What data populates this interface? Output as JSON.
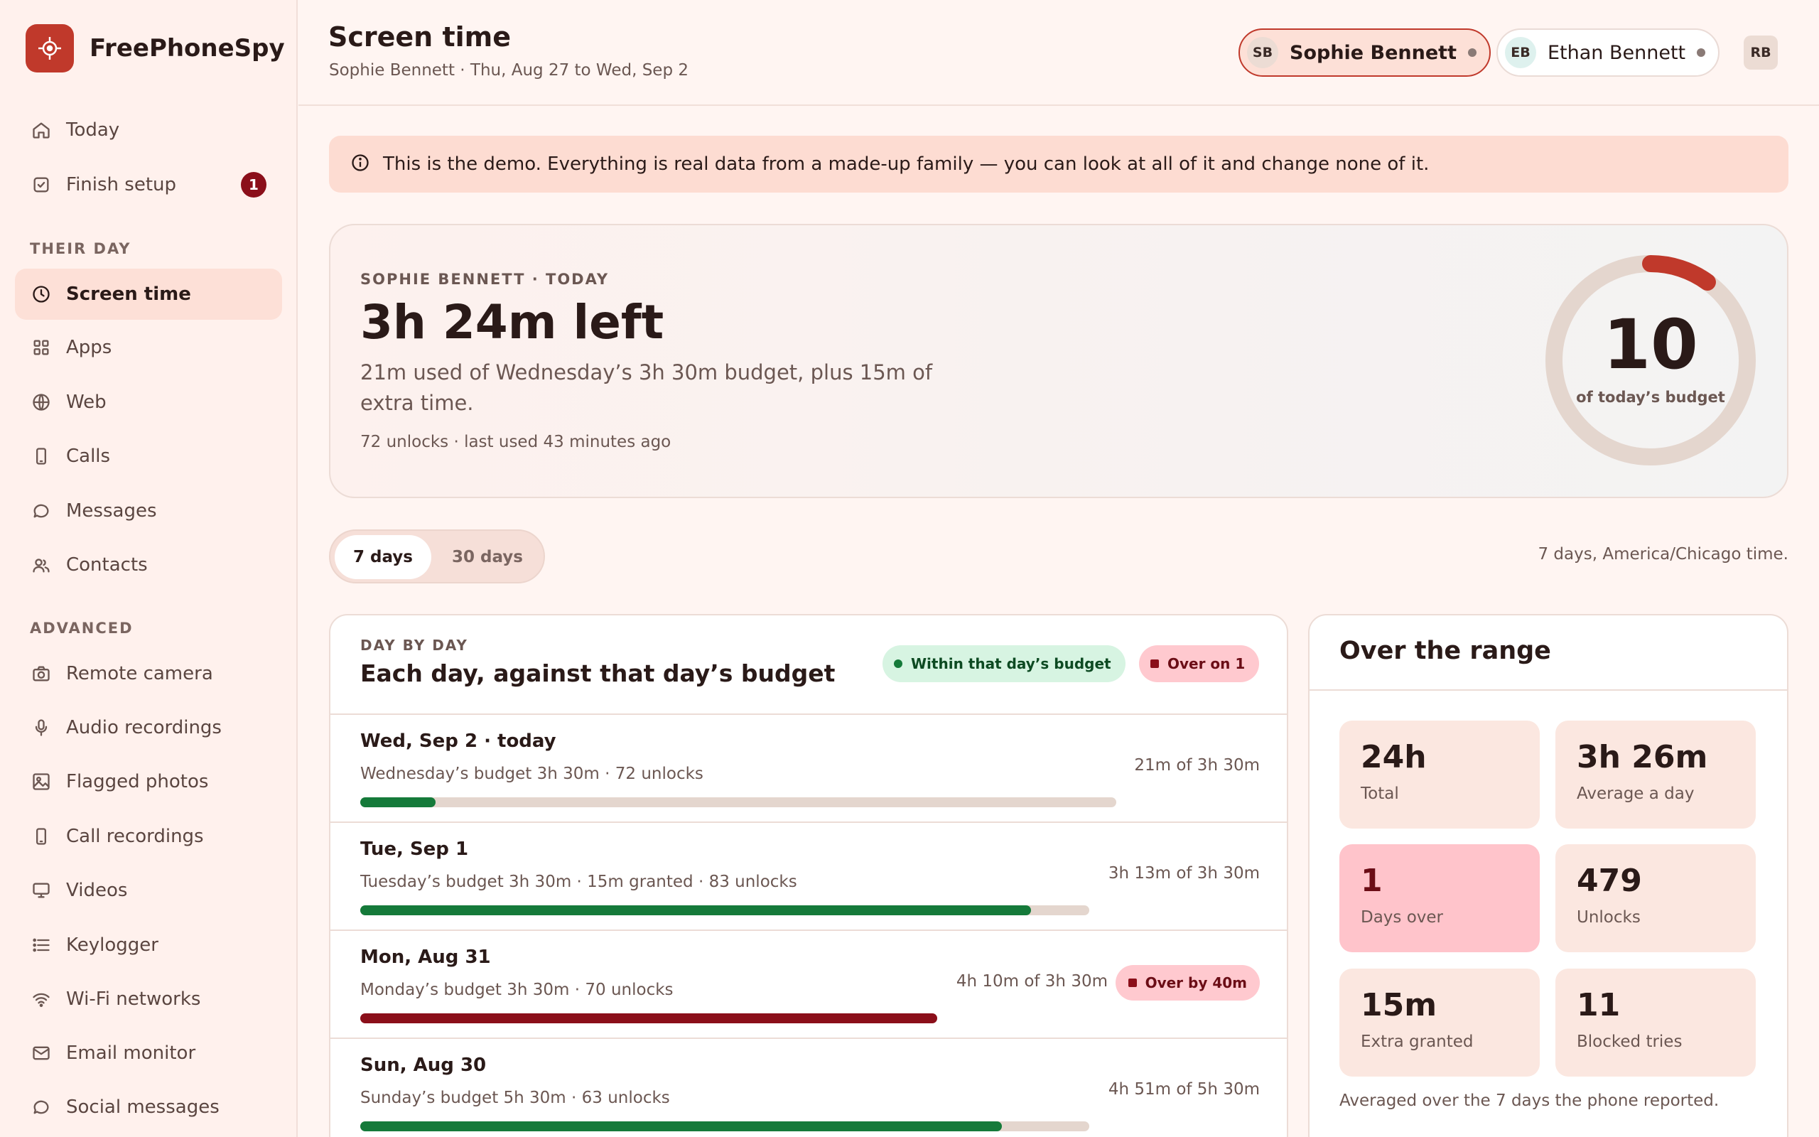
{
  "app": {
    "name": "FreePhoneSpy"
  },
  "sidebar": {
    "top": [
      {
        "label": "Today",
        "icon": "home-icon"
      },
      {
        "label": "Finish setup",
        "icon": "checkbox-icon",
        "badge": "1"
      }
    ],
    "section1": "THEIR DAY",
    "their_day": [
      {
        "label": "Screen time",
        "icon": "clock-icon",
        "active": true
      },
      {
        "label": "Apps",
        "icon": "grid-icon"
      },
      {
        "label": "Web",
        "icon": "globe-icon"
      },
      {
        "label": "Calls",
        "icon": "phone-icon"
      },
      {
        "label": "Messages",
        "icon": "chat-icon"
      },
      {
        "label": "Contacts",
        "icon": "people-icon"
      }
    ],
    "section2": "ADVANCED",
    "advanced": [
      {
        "label": "Remote camera",
        "icon": "camera-icon"
      },
      {
        "label": "Audio recordings",
        "icon": "mic-icon"
      },
      {
        "label": "Flagged photos",
        "icon": "image-icon"
      },
      {
        "label": "Call recordings",
        "icon": "phone-icon"
      },
      {
        "label": "Videos",
        "icon": "monitor-icon"
      },
      {
        "label": "Keylogger",
        "icon": "list-icon"
      },
      {
        "label": "Wi-Fi networks",
        "icon": "wifi-icon"
      },
      {
        "label": "Email monitor",
        "icon": "mail-icon"
      },
      {
        "label": "Social messages",
        "icon": "chat-icon"
      }
    ]
  },
  "header": {
    "title": "Screen time",
    "subtitle": "Sophie Bennett · Thu, Aug 27 to Wed, Sep 2",
    "profiles": [
      {
        "initials": "SB",
        "name": "Sophie Bennett",
        "active": true
      },
      {
        "initials": "EB",
        "name": "Ethan Bennett",
        "active": false
      }
    ],
    "user_initials": "RB"
  },
  "banner": {
    "text": "This is the demo. Everything is real data from a made-up family — you can look at all of it and change none of it."
  },
  "hero": {
    "kicker": "SOPHIE BENNETT · TODAY",
    "headline": "3h 24m left",
    "description": "21m used of Wednesday’s 3h 30m budget, plus 15m of extra time.",
    "meta": "72 unlocks · last used 43 minutes ago",
    "ring_value": "10",
    "ring_label": "of today’s budget",
    "ring_fraction": 0.1
  },
  "range_toggle": {
    "options": [
      "7 days",
      "30 days"
    ],
    "selected": "7 days"
  },
  "range_note": "7 days, America/Chicago time.",
  "day_by_day": {
    "kicker": "DAY BY DAY",
    "title": "Each day, against that day’s budget",
    "legend_within": "Within that day’s budget",
    "legend_over": "Over on 1",
    "days": [
      {
        "name": "Wed, Sep 2 · today",
        "budget": "Wednesday’s budget 3h 30m · 72 unlocks",
        "used": "21m of 3h 30m",
        "fraction": 0.1,
        "over": false,
        "flag": ""
      },
      {
        "name": "Tue, Sep 1",
        "budget": "Tuesday’s budget 3h 30m · 15m granted · 83 unlocks",
        "used": "3h 13m of 3h 30m",
        "fraction": 0.92,
        "over": false,
        "flag": ""
      },
      {
        "name": "Mon, Aug 31",
        "budget": "Monday’s budget 3h 30m · 70 unlocks",
        "used": "4h 10m of 3h 30m",
        "fraction": 1.0,
        "over": true,
        "flag": "Over by 40m"
      },
      {
        "name": "Sun, Aug 30",
        "budget": "Sunday’s budget 5h 30m · 63 unlocks",
        "used": "4h 51m of 5h 30m",
        "fraction": 0.88,
        "over": false,
        "flag": ""
      }
    ]
  },
  "over_range": {
    "title": "Over the range",
    "stats": [
      {
        "value": "24h",
        "label": "Total"
      },
      {
        "value": "3h 26m",
        "label": "Average a day"
      },
      {
        "value": "1",
        "label": "Days over",
        "alert": true
      },
      {
        "value": "479",
        "label": "Unlocks"
      },
      {
        "value": "15m",
        "label": "Extra granted"
      },
      {
        "value": "11",
        "label": "Blocked tries"
      }
    ],
    "footnote": "Averaged over the 7 days the phone reported."
  },
  "colors": {
    "accent": "#c0392b",
    "within": "#157a3a",
    "over": "#8b0f1a",
    "track": "#e4d6ce"
  }
}
